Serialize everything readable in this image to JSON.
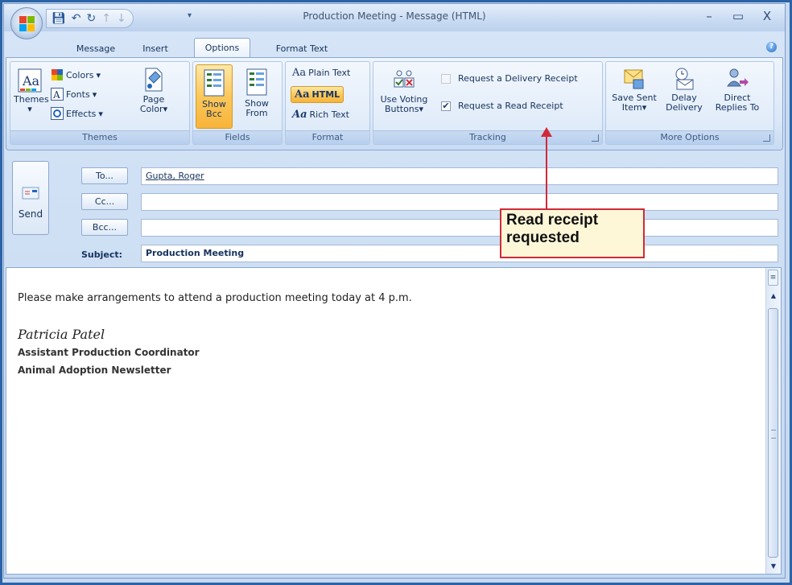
{
  "window": {
    "title": "Production Meeting - Message (HTML)",
    "minimize": "–",
    "maximize": "▭",
    "close": "X"
  },
  "tabs": [
    {
      "label": "Message"
    },
    {
      "label": "Insert"
    },
    {
      "label": "Options",
      "active": true
    },
    {
      "label": "Format Text"
    }
  ],
  "ribbon": {
    "themes": {
      "label": "Themes",
      "themes_button": "Themes",
      "colors": "Colors",
      "fonts": "Fonts",
      "effects": "Effects",
      "page_color_1": "Page",
      "page_color_2": "Color"
    },
    "fields": {
      "label": "Fields",
      "show_bcc_1": "Show",
      "show_bcc_2": "Bcc",
      "show_from_1": "Show",
      "show_from_2": "From"
    },
    "format": {
      "label": "Format",
      "plain_text": "Plain Text",
      "html": "HTML",
      "rich_text": "Rich Text",
      "selected": "HTML"
    },
    "tracking": {
      "label": "Tracking",
      "voting_1": "Use Voting",
      "voting_2": "Buttons",
      "delivery_receipt": "Request a Delivery Receipt",
      "delivery_receipt_checked": false,
      "read_receipt": "Request a Read Receipt",
      "read_receipt_checked": true
    },
    "more_options": {
      "label": "More Options",
      "save_sent_1": "Save Sent",
      "save_sent_2": "Item",
      "delay_1": "Delay",
      "delay_2": "Delivery",
      "direct_1": "Direct",
      "direct_2": "Replies To"
    }
  },
  "compose": {
    "send": "Send",
    "to_button": "To...",
    "cc_button": "Cc...",
    "bcc_button": "Bcc...",
    "subject_label": "Subject:",
    "to_value": "Gupta, Roger",
    "cc_value": "",
    "bcc_value": "",
    "subject_value": "Production Meeting"
  },
  "body": {
    "text": "Please make arrangements to attend a production meeting today at 4 p.m.",
    "signature_name": "Patricia Patel",
    "signature_title": "Assistant Production Coordinator",
    "signature_org": "Animal Adoption Newsletter"
  },
  "callout": {
    "line1": "Read receipt",
    "line2": "requested"
  },
  "colors": {
    "frame": "#2b63a6",
    "callout_border": "#d12a3a",
    "callout_fill": "#fdf7d8",
    "pressed": "#fbc85b"
  }
}
